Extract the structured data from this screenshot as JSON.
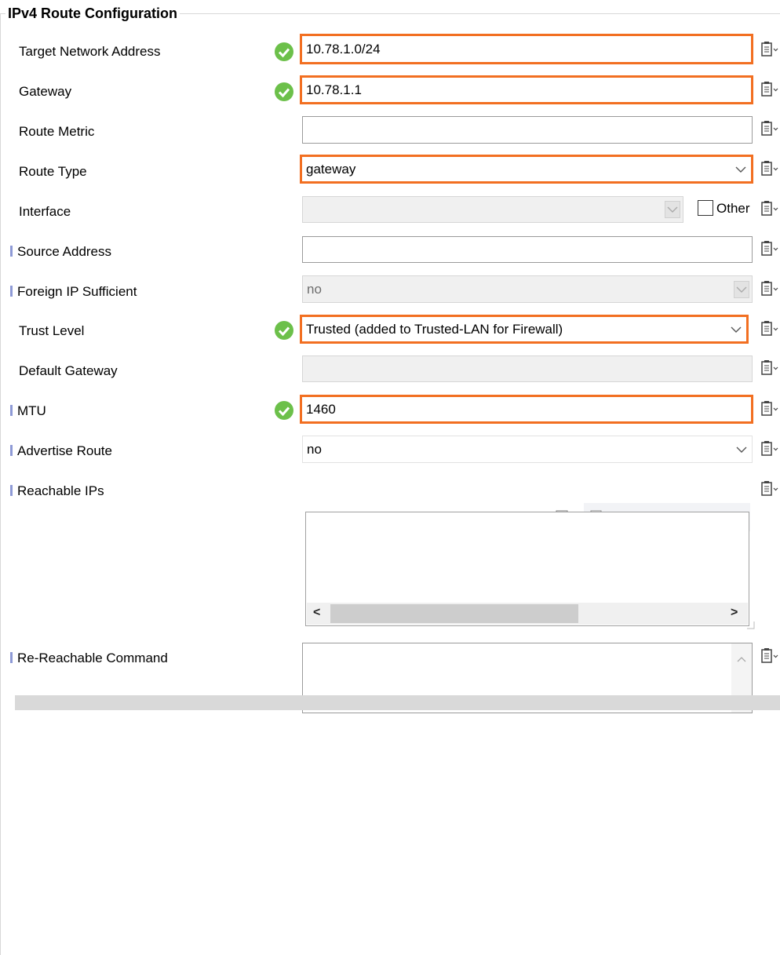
{
  "group": {
    "title": "IPv4 Route Configuration"
  },
  "fields": {
    "target": {
      "label": "Target Network Address",
      "value": "10.78.1.0/24"
    },
    "gateway": {
      "label": "Gateway",
      "value": "10.78.1.1"
    },
    "metric": {
      "label": "Route Metric",
      "value": ""
    },
    "route_type": {
      "label": "Route Type",
      "value": "gateway"
    },
    "interface": {
      "label": "Interface",
      "value": "",
      "other_label": "Other"
    },
    "source": {
      "label": "Source Address",
      "value": ""
    },
    "foreign_ip": {
      "label": "Foreign IP Sufficient",
      "value": "no"
    },
    "trust": {
      "label": "Trust Level",
      "value": "Trusted (added to Trusted-LAN for Firewall)"
    },
    "default_gw": {
      "label": "Default Gateway",
      "value": ""
    },
    "mtu": {
      "label": "MTU",
      "value": "1460"
    },
    "advertise": {
      "label": "Advertise Route",
      "value": "no"
    },
    "reachable": {
      "label": "Reachable IPs"
    },
    "rereach": {
      "label": "Re-Reachable Command"
    }
  },
  "colors": {
    "highlight": "#f26f21",
    "valid": "#6cc04a",
    "advanced_marker": "#8e9ad6"
  },
  "icons": {
    "valid": "check-circle-icon",
    "clipboard": "clipboard-menu-icon",
    "tools": [
      "import-icon",
      "clear-icon",
      "add-icon",
      "delete-icon",
      "move-up-icon",
      "move-down-icon"
    ]
  }
}
